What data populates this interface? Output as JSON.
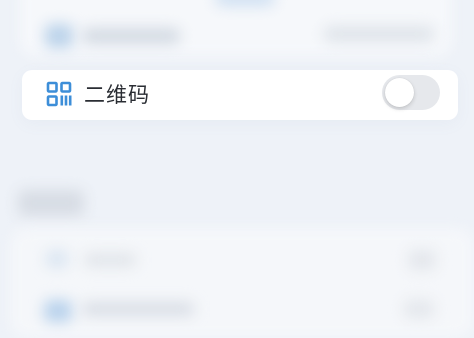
{
  "settings": {
    "qr_code_row": {
      "label": "二维码",
      "icon": "qr-code-icon",
      "toggle_on": false
    }
  },
  "colors": {
    "accent": "#3d8ed8",
    "toggle_off": "#e6e8ec",
    "background": "#eef2f8"
  }
}
